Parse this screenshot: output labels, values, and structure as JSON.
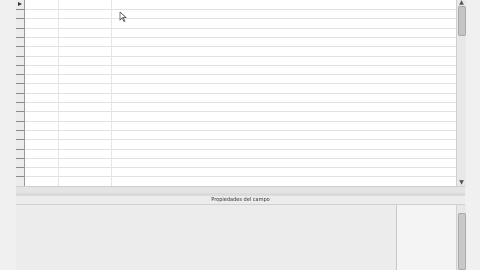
{
  "table_design": {
    "row_count": 20,
    "current_row": 1
  },
  "scrollbar": {
    "up_icon": "▲",
    "down_icon": "▼"
  },
  "field_properties": {
    "title": "Propiedades del campo"
  }
}
